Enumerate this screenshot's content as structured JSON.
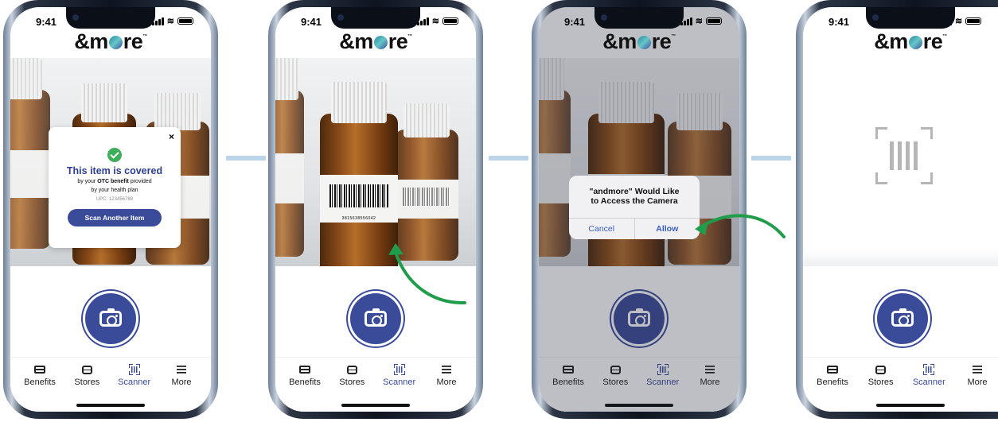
{
  "brand": {
    "logo_text_left": "&m",
    "logo_text_right": "re",
    "tm": "™"
  },
  "status": {
    "time": "9:41"
  },
  "tabs": [
    {
      "label": "Benefits",
      "icon": "card-icon"
    },
    {
      "label": "Stores",
      "icon": "store-icon"
    },
    {
      "label": "Scanner",
      "icon": "scanner-icon"
    },
    {
      "label": "More",
      "icon": "menu-icon"
    }
  ],
  "screen1": {
    "close": "×",
    "title": "This item is covered",
    "line1_prefix": "by your ",
    "line1_bold": "OTC benefit",
    "line1_suffix": " provided",
    "line2": "by your health plan",
    "upc": "UPC: 123456789",
    "button": "Scan Another Item"
  },
  "screen2": {
    "barcode_digits": "3815638556042"
  },
  "screen3": {
    "alert_title_1": "\"andmore\" Would Like",
    "alert_title_2": "to Access the Camera",
    "cancel": "Cancel",
    "allow": "Allow"
  },
  "colors": {
    "brand_blue": "#3a4b9a",
    "success_green": "#3fae5a",
    "arrow_green": "#1f9d4a",
    "connector": "#bcd4ea"
  }
}
